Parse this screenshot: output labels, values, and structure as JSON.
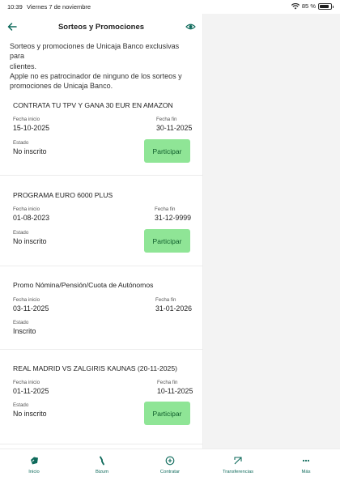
{
  "status": {
    "time": "10:39",
    "date": "Viernes 7 de noviembre",
    "battery": "85 %"
  },
  "header": {
    "title": "Sorteos y Promociones"
  },
  "intro": [
    "Sorteos y promociones de Unicaja Banco exclusivas para",
    "clientes.",
    "Apple no es patrocinador de ninguno de los sorteos y",
    "promociones de Unicaja Banco."
  ],
  "labels": {
    "start": "Fecha inicio",
    "end": "Fecha fin",
    "state": "Estado",
    "participate": "Participar"
  },
  "promos": [
    {
      "title": "CONTRATA TU TPV Y GANA 30 EUR EN AMAZON",
      "start": "15-10-2025",
      "end": "30-11-2025",
      "state": "No inscrito"
    },
    {
      "title": "PROGRAMA EURO 6000 PLUS",
      "start": "01-08-2023",
      "end": "31-12-9999",
      "state": "No inscrito"
    },
    {
      "title": "Promo Nómina/Pensión/Cuota de Autónomos",
      "start": "03-11-2025",
      "end": "31-01-2026",
      "state": "Inscrito"
    },
    {
      "title": "REAL MADRID VS ZALGIRIS KAUNAS (20-11-2025)",
      "start": "01-11-2025",
      "end": "10-11-2025",
      "state": "No inscrito"
    }
  ],
  "tabs": [
    {
      "label": "Inicio",
      "icon": "home-icon"
    },
    {
      "label": "Bizum",
      "icon": "bizum-icon"
    },
    {
      "label": "Contratar",
      "icon": "plus-circle-icon"
    },
    {
      "label": "Transferencias",
      "icon": "transfer-icon"
    },
    {
      "label": "Más",
      "icon": "more-dots-icon"
    }
  ],
  "colors": {
    "accent": "#0e6a5b",
    "button": "#8fe596",
    "button_text": "#0d5b2a"
  }
}
